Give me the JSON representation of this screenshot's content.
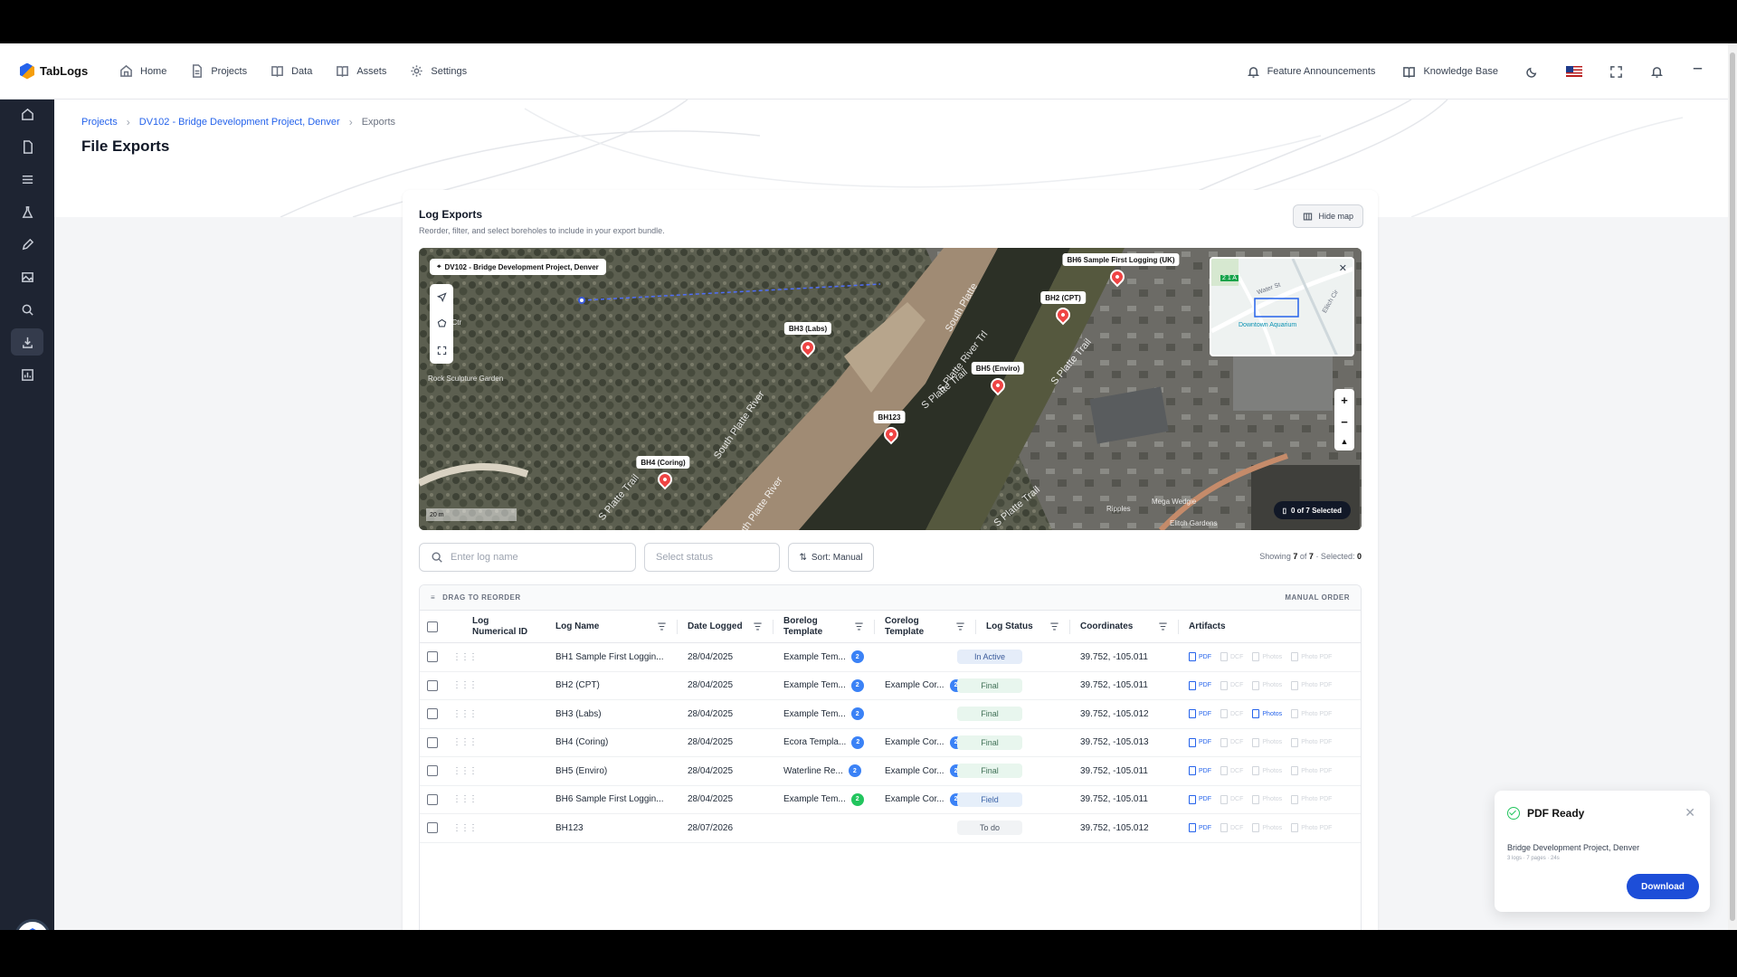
{
  "app": {
    "name": "TabLogs"
  },
  "nav": {
    "items": [
      {
        "label": "Home",
        "icon": "home-icon"
      },
      {
        "label": "Projects",
        "icon": "file-icon"
      },
      {
        "label": "Data",
        "icon": "book-icon"
      },
      {
        "label": "Assets",
        "icon": "book-icon"
      },
      {
        "label": "Settings",
        "icon": "gear-icon"
      }
    ],
    "right": {
      "announcements": "Feature Announcements",
      "knowledge_base": "Knowledge Base"
    }
  },
  "breadcrumb": {
    "projects": "Projects",
    "project": "DV102 - Bridge Development Project, Denver",
    "current": "Exports"
  },
  "page": {
    "title": "File Exports"
  },
  "card": {
    "title": "Log Exports",
    "subtitle": "Reorder, filter, and select boreholes to include in your export bundle.",
    "hide_map": "Hide map"
  },
  "map": {
    "project_label": "DV102 - Bridge Development Project, Denver",
    "pins": [
      {
        "label": "BH6 Sample First Logging (UK)"
      },
      {
        "label": "BH2 (CPT)"
      },
      {
        "label": "BH3 (Labs)"
      },
      {
        "label": "BH5 (Enviro)"
      },
      {
        "label": "BH123"
      },
      {
        "label": "BH4 (Coring)"
      }
    ],
    "place_labels": {
      "sculpture": "Rock Sculpture Garden",
      "rec": "Rec Ctr",
      "ripples": "Ripples",
      "mega": "Mega Wedgie",
      "elitch": "Elitch Gardens",
      "river1": "South Platte River",
      "river2": "South Platte River",
      "river3": "South Platte",
      "trail1": "S Platte River Trl",
      "trail2": "S Platte Trail",
      "trail3": "S Platte Trail",
      "trail4": "S Platte Trail",
      "trail5": "S Platte Trail"
    },
    "minimap": {
      "street": "Water St",
      "aquarium": "Downtown Aquarium",
      "elitch": "Elitch Cir",
      "route": "2 1 A"
    },
    "scale": "20 m",
    "selected_chip": "0 of 7 Selected"
  },
  "filters": {
    "search_placeholder": "Enter log name",
    "status_placeholder": "Select status",
    "sort_label": "Sort: Manual",
    "showing_prefix": "Showing",
    "showing_count": "7",
    "showing_of": "of",
    "showing_total": "7",
    "selected_label": "· Selected:",
    "selected_count": "0"
  },
  "table": {
    "drag_label": "DRAG TO REORDER",
    "order_label": "MANUAL ORDER",
    "columns": {
      "numerical_id": "Log\nNumerical ID",
      "log_name": "Log Name",
      "date_logged": "Date Logged",
      "borelog": "Borelog\nTemplate",
      "corelog": "Corelog\nTemplate",
      "status": "Log Status",
      "coordinates": "Coordinates",
      "artifacts": "Artifacts"
    },
    "rows": [
      {
        "name": "BH1 Sample First Loggin...",
        "date": "28/04/2025",
        "borelog": "Example Tem...",
        "borelog_v": "2",
        "corelog": "",
        "corelog_v": "",
        "status": "In Active",
        "coords": "39.752, -105.011",
        "photos": false
      },
      {
        "name": "BH2 (CPT)",
        "date": "28/04/2025",
        "borelog": "Example Tem...",
        "borelog_v": "2",
        "corelog": "Example Cor...",
        "corelog_v": "2",
        "status": "Final",
        "coords": "39.752, -105.011",
        "photos": false
      },
      {
        "name": "BH3 (Labs)",
        "date": "28/04/2025",
        "borelog": "Example Tem...",
        "borelog_v": "2",
        "corelog": "",
        "corelog_v": "",
        "status": "Final",
        "coords": "39.752, -105.012",
        "photos": true
      },
      {
        "name": "BH4 (Coring)",
        "date": "28/04/2025",
        "borelog": "Ecora Templa...",
        "borelog_v": "2",
        "corelog": "Example Cor...",
        "corelog_v": "2",
        "status": "Final",
        "coords": "39.752, -105.013",
        "photos": false
      },
      {
        "name": "BH5 (Enviro)",
        "date": "28/04/2025",
        "borelog": "Waterline Re...",
        "borelog_v": "2",
        "corelog": "Example Cor...",
        "corelog_v": "2",
        "status": "Final",
        "coords": "39.752, -105.011",
        "photos": false
      },
      {
        "name": "BH6 Sample First Loggin...",
        "date": "28/04/2025",
        "borelog": "Example Tem...",
        "borelog_v": "2",
        "corelog": "Example Cor...",
        "corelog_v": "2",
        "status": "Field",
        "coords": "39.752, -105.011",
        "photos": false
      },
      {
        "name": "BH123",
        "date": "28/07/2026",
        "borelog": "",
        "borelog_v": "",
        "corelog": "",
        "corelog_v": "",
        "status": "To do",
        "coords": "39.752, -105.012",
        "photos": false
      }
    ],
    "artifact_labels": {
      "pdf": "PDF",
      "dcf": "DCF",
      "photos": "Photos",
      "photo_pdf": "Photo PDF"
    }
  },
  "toast": {
    "title": "PDF Ready",
    "subtitle": "Bridge Development Project, Denver",
    "meta": "3 logs · 7 pages · 24s",
    "download": "Download"
  },
  "colors": {
    "accent": "#2563eb",
    "sidebar": "#1e2432",
    "pin": "#ef4444",
    "download": "#1d4ed8"
  }
}
